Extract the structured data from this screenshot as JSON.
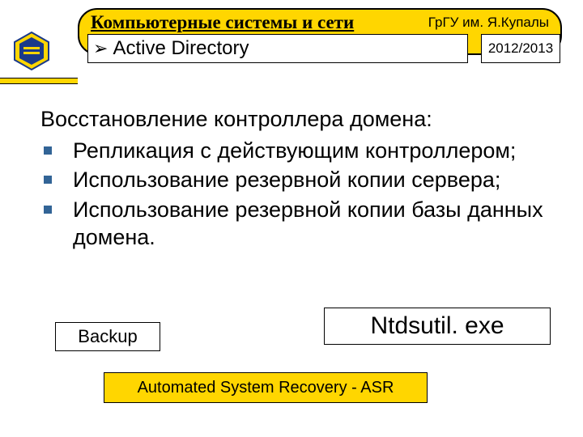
{
  "header": {
    "course_title": "Компьютерные системы и сети",
    "university": "ГрГУ им. Я.Купалы",
    "subtopic_arrow": "➢",
    "subtopic": "Active Directory",
    "academic_year": "2012/2013"
  },
  "body": {
    "heading": "Восстановление контроллера домена:",
    "items": [
      "Репликация с действующим контроллером;",
      "Использование резервной  копии сервера;",
      "Использование резервной копии базы данных домена."
    ]
  },
  "boxes": {
    "backup": "Backup",
    "ntds": "Ntdsutil. exe",
    "asr": "Automated System Recovery - ASR"
  }
}
